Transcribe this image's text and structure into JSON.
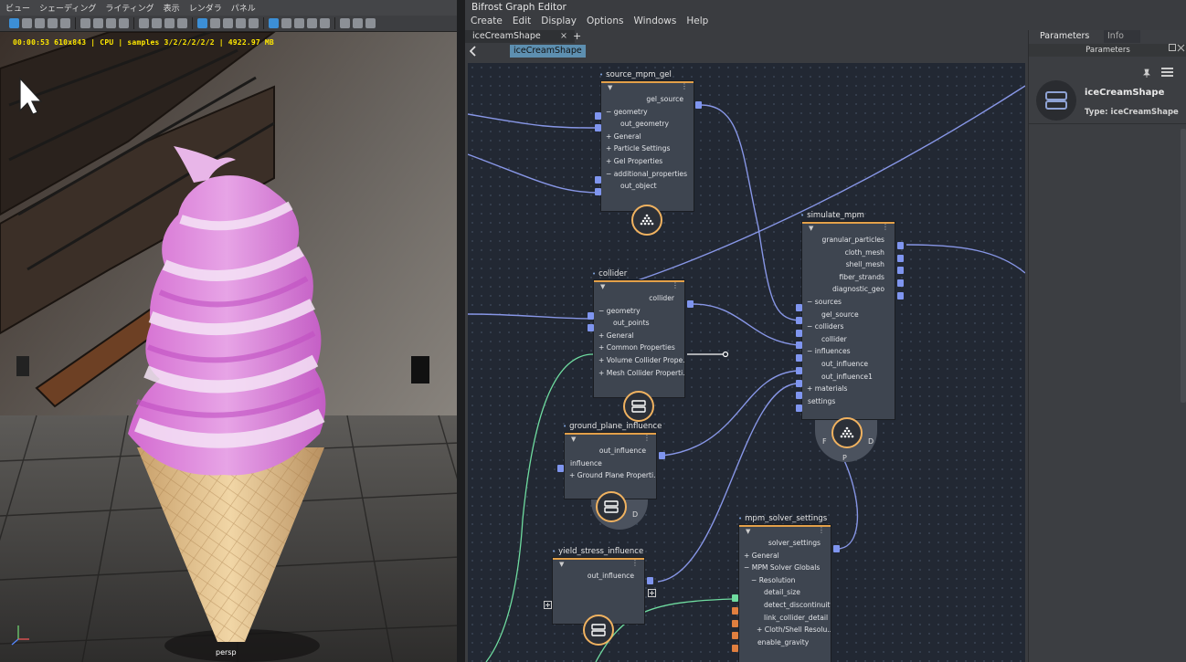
{
  "viewport": {
    "menu": [
      "ビュー",
      "シェーディング",
      "ライティング",
      "表示",
      "レンダラ",
      "パネル"
    ],
    "hud": "00:00:53 610x843 | CPU | samples 3/2/2/2/2/2 | 4922.97 MB",
    "camera": "persp"
  },
  "graph_editor": {
    "title": "Bifrost Graph Editor",
    "menu": [
      "Create",
      "Edit",
      "Display",
      "Options",
      "Windows",
      "Help"
    ],
    "tab_label": "iceCreamShape",
    "tab_close": "×",
    "tab_add": "+",
    "breadcrumb": "iceCreamShape",
    "nodes": {
      "source_mpm_gel": {
        "title": "source_mpm_gel",
        "ports": [
          "gel_source",
          "geometry",
          "out_geometry",
          "General",
          "Particle Settings",
          "Gel Properties",
          "additional_properties",
          "out_object"
        ]
      },
      "collider": {
        "title": "collider",
        "ports": [
          "collider",
          "geometry",
          "out_points",
          "General",
          "Common Properties",
          "Volume Collider Prope...",
          "Mesh Collider Properti..."
        ]
      },
      "ground_plane_influence": {
        "title": "ground_plane_influence",
        "ports": [
          "out_influence",
          "influence",
          "Ground Plane Properti..."
        ],
        "ring_letter": "D"
      },
      "yield_stress_influence": {
        "title": "yield_stress_influence",
        "ports": [
          "out_influence"
        ]
      },
      "simulate_mpm": {
        "title": "simulate_mpm",
        "ports": [
          "granular_particles",
          "cloth_mesh",
          "shell_mesh",
          "fiber_strands",
          "diagnostic_geo",
          "sources",
          "gel_source",
          "colliders",
          "collider",
          "influences",
          "out_influence",
          "out_influence1",
          "materials",
          "settings"
        ],
        "ring_letters": [
          "F",
          "P",
          "D"
        ]
      },
      "mpm_solver_settings": {
        "title": "mpm_solver_settings",
        "ports": [
          "solver_settings",
          "General",
          "MPM Solver Globals",
          "Resolution",
          "detail_size",
          "detect_discontinuity",
          "link_collider_detail",
          "Cloth/Shell Resolu...",
          "enable_gravity"
        ]
      }
    }
  },
  "parameters_panel": {
    "tab_parameters": "Parameters",
    "tab_info": "Info",
    "header": "Parameters",
    "node_name": "iceCreamShape",
    "node_type": "Type: iceCreamShape"
  },
  "colors": {
    "node_accent": "#e3a049",
    "port_blue": "#7f95ef",
    "port_orange": "#e07f3f",
    "wire_blue": "#8796e6",
    "wire_green": "#6fdca0",
    "canvas_bg": "#222833",
    "hud_yellow": "#ffe800"
  }
}
